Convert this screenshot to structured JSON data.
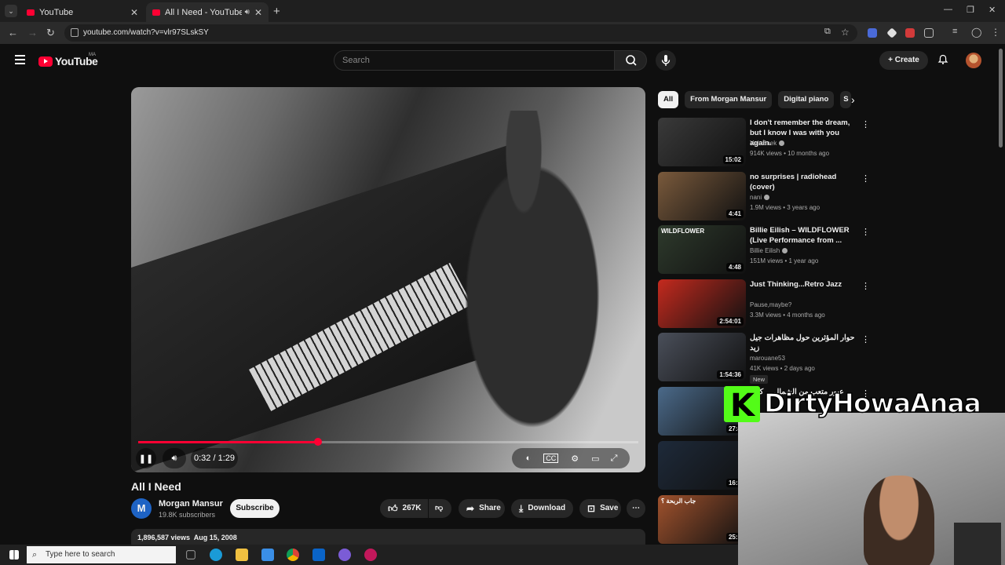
{
  "browser": {
    "tabs": [
      {
        "title": "YouTube",
        "active": false
      },
      {
        "title": "All I Need - YouTube",
        "active": true
      }
    ],
    "url": "youtube.com/watch?v=vlr97SLskSY"
  },
  "header": {
    "logo": "YouTube",
    "country": "MA",
    "search_placeholder": "Search",
    "create_label": "Create"
  },
  "player": {
    "time": "0:32 / 1:29",
    "progress": 0.36
  },
  "video": {
    "title": "All I Need",
    "channel": "Morgan Mansur",
    "channel_initial": "M",
    "subscribers": "19.8K subscribers",
    "subscribe_label": "Subscribe",
    "likes": "267K",
    "share_label": "Share",
    "download_label": "Download",
    "save_label": "Save",
    "views_date": "1,896,587 views  Aug 15, 2008"
  },
  "chips": [
    "All",
    "From Morgan Mansur",
    "Digital piano",
    "S"
  ],
  "recommendations": [
    {
      "title": "I don't remember the dream, but I know I was with you again.",
      "channel": "Yuh Baek",
      "verified": true,
      "meta": "914K views • 10 months ago",
      "duration": "15:02",
      "thumb": "#3a3a3a"
    },
    {
      "title": "no surprises | radiohead (cover)",
      "channel": "nani",
      "verified": true,
      "meta": "1.9M views • 3 years ago",
      "duration": "4:41",
      "thumb": "#7a5a3c"
    },
    {
      "title": "Billie Eilish – WILDFLOWER (Live Performance from ...",
      "channel": "Billie Eilish",
      "verified": true,
      "meta": "151M views • 1 year ago",
      "duration": "4:48",
      "thumb": "#2e3a2c",
      "thumb_text": "WILDFLOWER"
    },
    {
      "title": "Just Thinking...Retro Jazz",
      "channel": "Pause,maybe?",
      "verified": false,
      "meta": "3.3M views • 4 months ago",
      "duration": "2:54:01",
      "thumb": "#c42a1e"
    },
    {
      "title": "حوار المؤثرين حول مظاهرات جيل زيد",
      "channel": "marouane53",
      "verified": false,
      "meta": "41K views • 2 days ago",
      "duration": "1:54:36",
      "thumb": "#4a4f5a",
      "badge": "New"
    },
    {
      "title": "عبور متعب من الشمال ... كيف",
      "channel": "",
      "verified": false,
      "meta": "",
      "duration": "27:4",
      "thumb": "#4b6a8a"
    },
    {
      "title": "",
      "channel": "",
      "verified": false,
      "meta": "",
      "duration": "16:3",
      "thumb": "#1e2a3a"
    },
    {
      "title": "",
      "channel": "",
      "verified": false,
      "meta": "",
      "duration": "25:1",
      "thumb": "#a0522d",
      "thumb_text": "جاب الربحة ؟"
    }
  ],
  "stream_overlay": {
    "name": "DirtyHowaAnaa"
  },
  "taskbar": {
    "search_placeholder": "Type here to search"
  },
  "colors": {
    "accent": "#ff0033",
    "kick_green": "#53fc18",
    "background": "#0f0f0f"
  }
}
